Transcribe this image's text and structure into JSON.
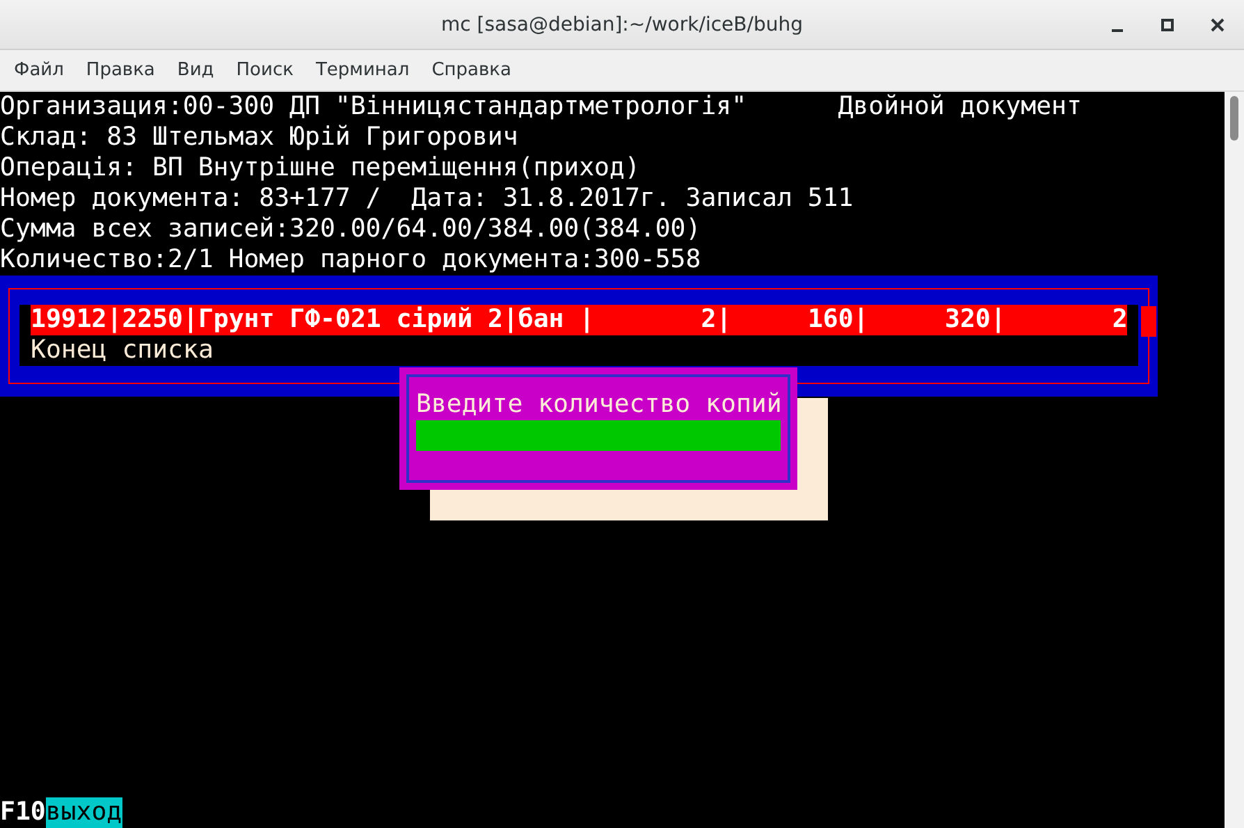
{
  "window": {
    "title": "mc [sasa@debian]:~/work/iceB/buhg"
  },
  "menu": [
    "Файл",
    "Правка",
    "Вид",
    "Поиск",
    "Терминал",
    "Справка"
  ],
  "header_lines": [
    "Организация:00-300 ДП \"Вінницястандартметрологія\"",
    "Склад: 83 Штельмах Юрій Григорович",
    "Операція: ВП Внутрішне переміщення(приход)",
    "Номер документа: 83+177 /  Дата: 31.8.2017г. Записал 511",
    "Сумма всех записей:320.00/64.00/384.00(384.00)",
    "Количество:2/1 Номер парного документа:300-558"
  ],
  "header_right": "Двойной документ",
  "list": {
    "rows": [
      {
        "text": "19912|2250|Грунт ГФ-021 сірий 2|бан |       2|     160|     320|       2",
        "selected": true
      },
      {
        "text": "Конец списка",
        "selected": false
      }
    ]
  },
  "dialog": {
    "prompt": "Введите количество копий"
  },
  "function_keys": [
    {
      "key": "F10",
      "label": "выход"
    }
  ]
}
